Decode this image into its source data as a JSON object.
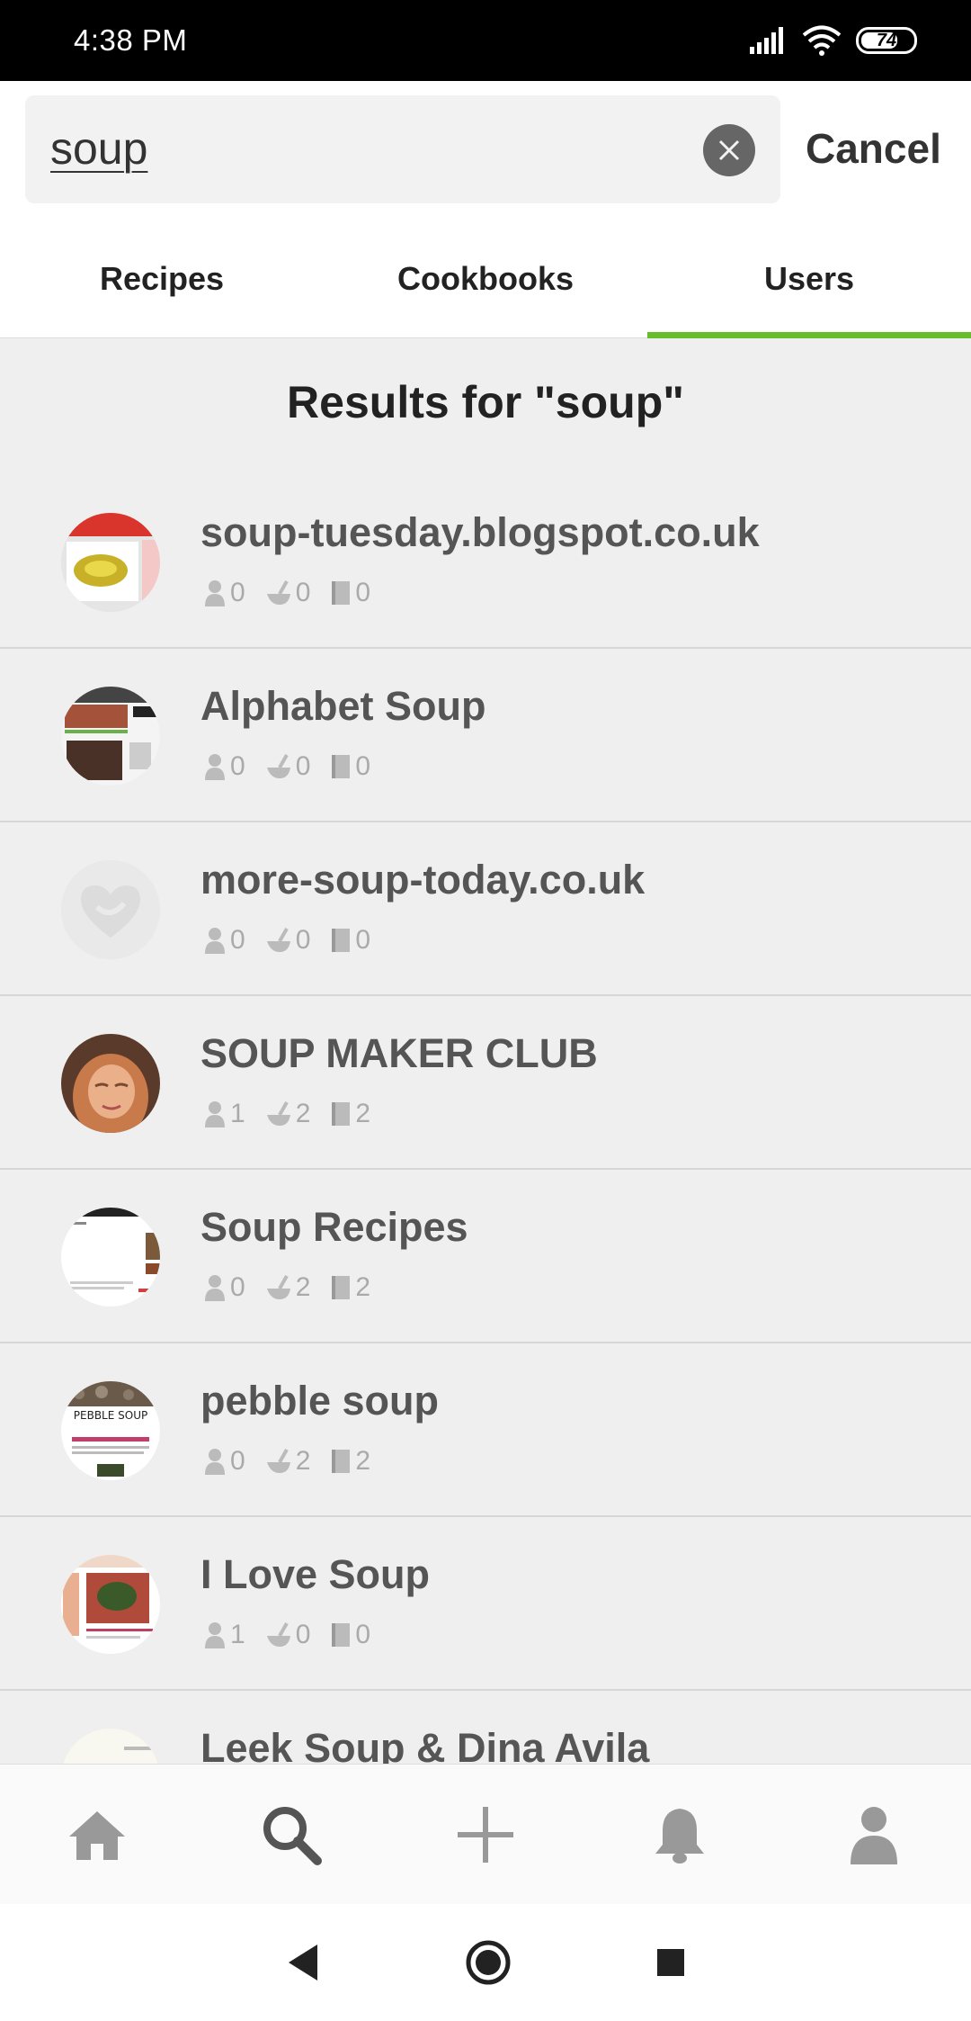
{
  "status_bar": {
    "time": "4:38 PM",
    "battery": "74"
  },
  "search": {
    "query": "soup",
    "cancel_label": "Cancel"
  },
  "tabs": [
    {
      "label": "Recipes",
      "active": false
    },
    {
      "label": "Cookbooks",
      "active": false
    },
    {
      "label": "Users",
      "active": true
    }
  ],
  "results_heading": "Results for \"soup\"",
  "results": [
    {
      "name": "soup-tuesday.blogspot.co.uk",
      "followers": "0",
      "recipes": "0",
      "cookbooks": "0"
    },
    {
      "name": "Alphabet Soup",
      "followers": "0",
      "recipes": "0",
      "cookbooks": "0"
    },
    {
      "name": "more-soup-today.co.uk",
      "followers": "0",
      "recipes": "0",
      "cookbooks": "0"
    },
    {
      "name": "SOUP MAKER CLUB",
      "followers": "1",
      "recipes": "2",
      "cookbooks": "2"
    },
    {
      "name": "Soup Recipes",
      "followers": "0",
      "recipes": "2",
      "cookbooks": "2"
    },
    {
      "name": "pebble soup",
      "followers": "0",
      "recipes": "2",
      "cookbooks": "2"
    },
    {
      "name": "I Love Soup",
      "followers": "1",
      "recipes": "0",
      "cookbooks": "0"
    },
    {
      "name": "Leek Soup & Dina Avila",
      "followers": "",
      "recipes": "",
      "cookbooks": ""
    }
  ],
  "avatar_labels": {
    "pebble_soup": "PEBBLE SOUP"
  },
  "bottom_nav": [
    "home-icon",
    "search-icon",
    "add-icon",
    "bell-icon",
    "profile-icon"
  ],
  "colors": {
    "accent": "#67bd2c",
    "text_muted": "#555555",
    "stat_icon": "#aaaaaa"
  }
}
